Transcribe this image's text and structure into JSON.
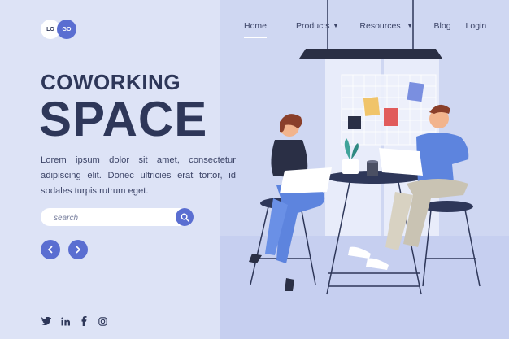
{
  "logo": {
    "left": "LO",
    "right": "GO"
  },
  "nav": {
    "home": "Home",
    "products": "Products",
    "resources": "Resources",
    "blog": "Blog",
    "login": "Login"
  },
  "hero": {
    "title_line1": "COWORKING",
    "title_line2": "SPACE",
    "description": "Lorem ipsum dolor sit amet, consectetur adipiscing elit. Donec ultricies erat tortor, id sodales turpis rutrum eget."
  },
  "search": {
    "placeholder": "search",
    "icon": "search-icon"
  },
  "carousel": {
    "prev_icon": "chevron-left-icon",
    "next_icon": "chevron-right-icon"
  },
  "social": [
    "twitter-icon",
    "linkedin-icon",
    "facebook-icon",
    "instagram-icon"
  ],
  "colors": {
    "background": "#dde3f6",
    "accent": "#5a6ed1",
    "dark_text": "#2e3759"
  }
}
